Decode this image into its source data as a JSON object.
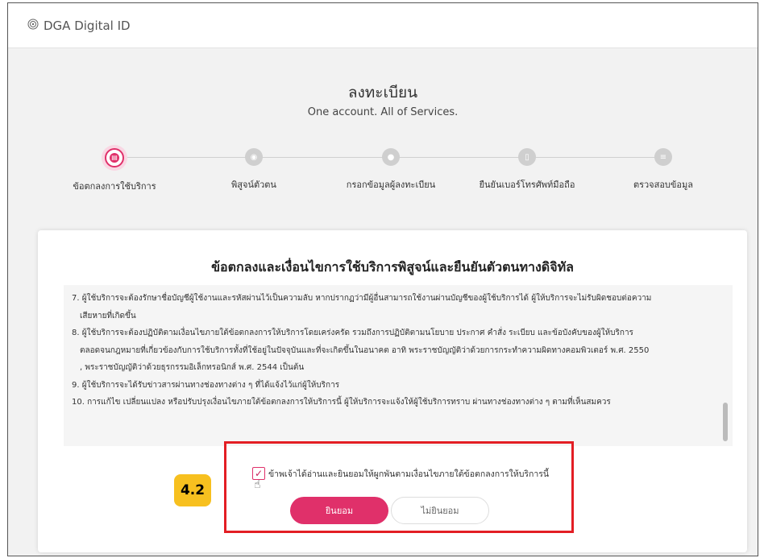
{
  "app": {
    "title": "DGA Digital ID",
    "logo_icon": "fingerprint-icon"
  },
  "header": {
    "title": "ลงทะเบียน",
    "subtitle": "One account. All of Services."
  },
  "steps": [
    {
      "label": "ข้อตกลงการใช้บริการ",
      "icon": "document-icon",
      "active": true
    },
    {
      "label": "พิสูจน์ตัวตน",
      "icon": "fingerprint-icon",
      "active": false
    },
    {
      "label": "กรอกข้อมูลผู้ลงทะเบียน",
      "icon": "user-icon",
      "active": false
    },
    {
      "label": "ยืนยันเบอร์โทรศัพท์มือถือ",
      "icon": "phone-icon",
      "active": false
    },
    {
      "label": "ตรวจสอบข้อมูล",
      "icon": "check-list-icon",
      "active": false
    }
  ],
  "card": {
    "title": "ข้อตกลงและเงื่อนไขการใช้บริการพิสูจน์และยืนยันตัวตนทางดิจิทัล",
    "terms": [
      "7. ผู้ใช้บริการจะต้องรักษาชื่อบัญชีผู้ใช้งานและรหัสผ่านไว้เป็นความลับ หากปรากฏว่ามีผู้อื่นสามารถใช้งานผ่านบัญชีของผู้ใช้บริการได้ ผู้ให้บริการจะไม่รับผิดชอบต่อความ",
      "เสียหายที่เกิดขึ้น",
      "8. ผู้ใช้บริการจะต้องปฏิบัติตามเงื่อนไขภายใต้ข้อตกลงการให้บริการโดยเคร่งครัด รวมถึงการปฏิบัติตามนโยบาย ประกาศ คำสั่ง ระเบียบ และข้อบังคับของผู้ให้บริการ",
      "ตลอดจนกฎหมายที่เกี่ยวข้องกับการใช้บริการทั้งที่ใช้อยู่ในปัจจุบันและที่จะเกิดขึ้นในอนาคต อาทิ พระราชบัญญัติว่าด้วยการกระทำความผิดทางคอมพิวเตอร์ พ.ศ. 2550",
      ", พระราชบัญญัติว่าด้วยธุรกรรมอิเล็กทรอนิกส์ พ.ศ. 2544 เป็นต้น",
      "9. ผู้ใช้บริการจะได้รับข่าวสารผ่านทางช่องทางต่าง ๆ ที่ได้แจ้งไว้แก่ผู้ให้บริการ",
      "10. การแก้ไข เปลี่ยนแปลง หรือปรับปรุงเงื่อนไขภายใต้ข้อตกลงการให้บริการนี้ ผู้ให้บริการจะแจ้งให้ผู้ใช้บริการทราบ ผ่านทางช่องทางต่าง ๆ ตามที่เห็นสมควร"
    ],
    "consent_label": "ข้าพเจ้าได้อ่านและยินยอมให้ผูกพันตามเงื่อนไขภายใต้ข้อตกลงการให้บริการนี้",
    "consent_checked": true,
    "accept_label": "ยินยอม",
    "decline_label": "ไม่ยินยอม"
  },
  "annotation": {
    "badge": "4.2",
    "highlight_color": "#e31e24",
    "badge_color": "#f7c01f"
  },
  "colors": {
    "accent": "#e0306a",
    "inactive_step": "#cfcfcf"
  }
}
